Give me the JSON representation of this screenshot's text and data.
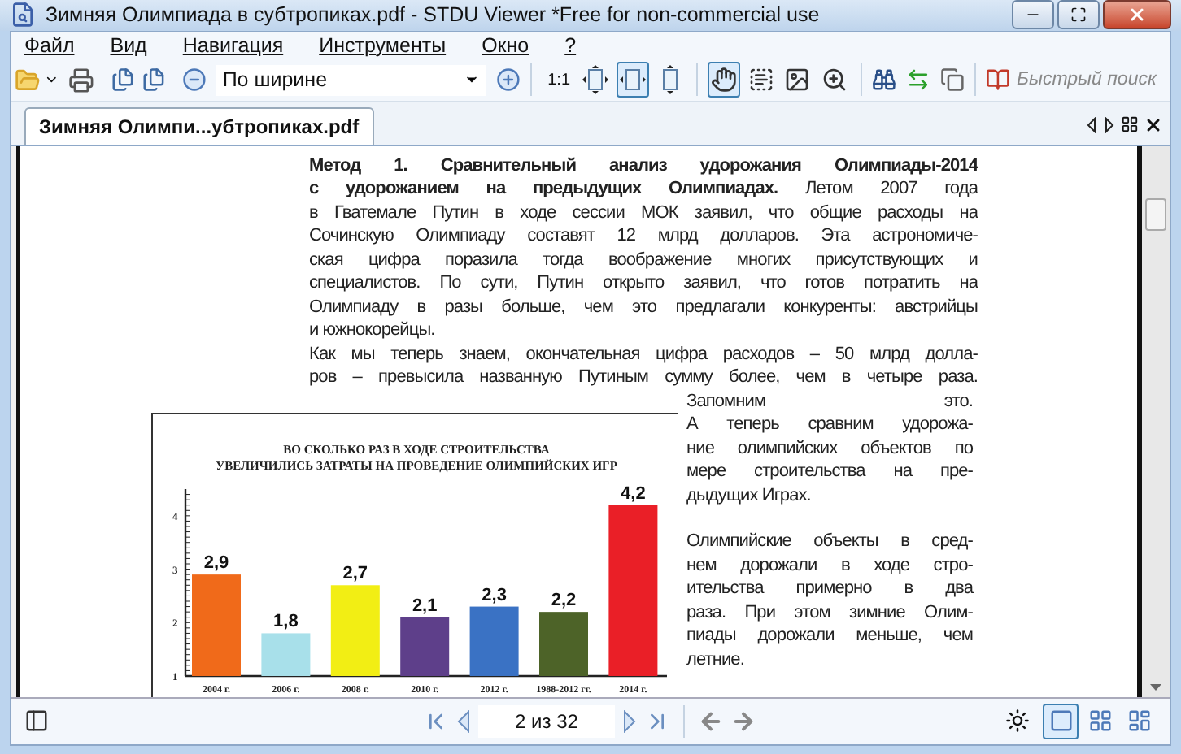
{
  "window": {
    "title": "Зимняя Олимпиада в субтропиках.pdf - STDU Viewer *Free for non-commercial use"
  },
  "menu": [
    "Файл",
    "Вид",
    "Навигация",
    "Инструменты",
    "Окно",
    "?"
  ],
  "toolbar": {
    "zoom_combo": {
      "value": "По ширине"
    },
    "zoom_modes": [
      {
        "label": "1:1",
        "selected": false
      },
      {
        "selected": false
      },
      {
        "selected": true
      },
      {
        "selected": false
      }
    ],
    "tools": [
      {
        "selected": true
      },
      {
        "selected": false
      },
      {
        "selected": false
      },
      {
        "selected": false
      }
    ],
    "search": {
      "placeholder": "Быстрый поиск"
    }
  },
  "tabs": [
    {
      "label": "Зимняя Олимпи...убтропиках.pdf",
      "selected": true
    }
  ],
  "document": {
    "paragraphs": [
      {
        "lines": [
          "**Метод 1. Сравнительный анализ удорожания Олимпиады-2014**",
          "**с удорожанием на предыдущих Олимпиадах.** Летом 2007 года",
          "в Гватемале Путин в ходе сессии МОК заявил, что общие расходы на",
          "Сочинскую Олимпиаду составят 12 млрд долларов. Эта астрономиче-",
          "ская цифра поразила тогда воображение многих присутствующих и",
          "специалистов. По сути, Путин открыто заявил, что готов потратить на",
          "Олимпиаду в разы больше, чем это предлагали конкуренты: австрийцы",
          "и южнокорейцы."
        ]
      },
      {
        "lines": [
          "Как мы теперь знаем, окончательная цифра расходов – 50 млрд долла-",
          "ров –  превысила названную Путиным сумму более, чем в четыре раза."
        ]
      }
    ],
    "side_paragraphs": [
      {
        "lines": [
          "Запомним это.",
          "А теперь сравним удорожа-",
          "ние олимпийских объектов по",
          "мере строительства на пре-",
          "дыдущих Играх."
        ]
      },
      {
        "lines": [
          "Олимпийские объекты в сред-",
          "нем дорожали в ходе стро-",
          "ительства примерно в два",
          "раза. При этом зимние Олим-",
          "пиады дорожали меньше, чем",
          "летние."
        ]
      }
    ],
    "chart_data": {
      "type": "bar",
      "title": "ВО СКОЛЬКО РАЗ В ХОДЕ СТРОИТЕЛЬСТВА\nУВЕЛИЧИЛИСЬ ЗАТРАТЫ НА ПРОВЕДЕНИЕ ОЛИМПИЙСКИХ ИГР",
      "categories": [
        "2004 г.",
        "2006 г.",
        "2008 г.",
        "2010 г.",
        "2012 г.",
        "1988-2012 гг.",
        "2014 г."
      ],
      "values": [
        2.9,
        1.8,
        2.7,
        2.1,
        2.3,
        2.2,
        4.2
      ],
      "colors": [
        "#f06a1a",
        "#a8e0ea",
        "#f2ee14",
        "#5e3f8a",
        "#3a72c4",
        "#4d6328",
        "#ea1f27"
      ],
      "value_labels": [
        "2,9",
        "1,8",
        "2,7",
        "2,1",
        "2,3",
        "2,2",
        "4,2"
      ],
      "ylim": [
        1,
        4.5
      ],
      "yticks": [
        1,
        2,
        3,
        4
      ]
    }
  },
  "status_bar": {
    "page_field": {
      "value": "2 из 32"
    },
    "view_modes": [
      {
        "selected": true
      },
      {
        "selected": false
      },
      {
        "selected": false
      }
    ]
  }
}
